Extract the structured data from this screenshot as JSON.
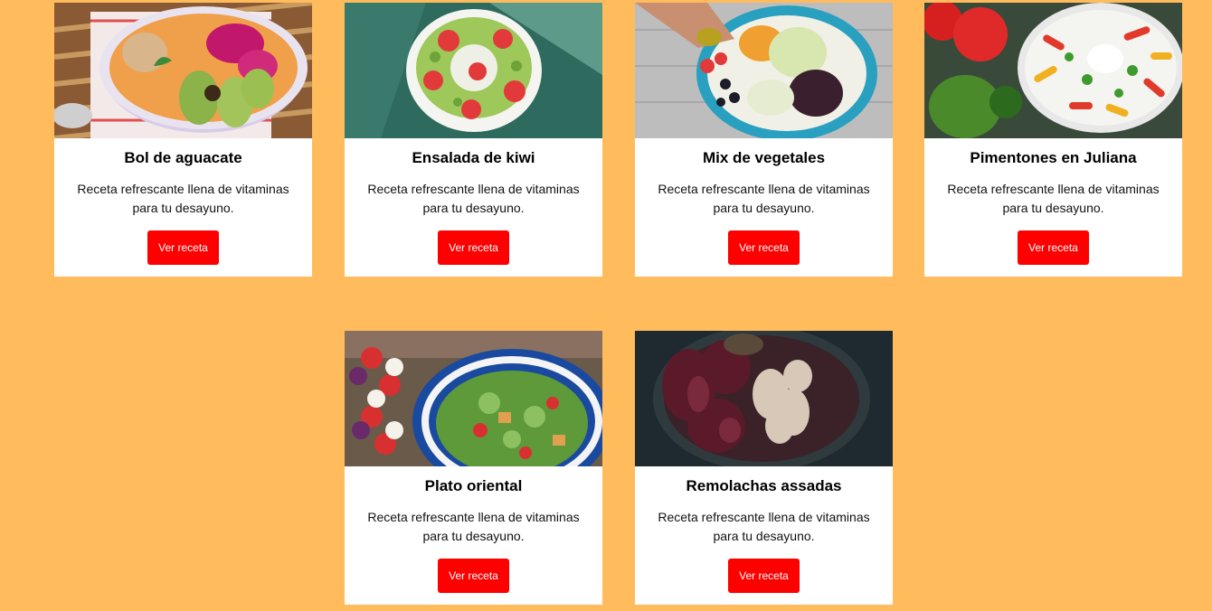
{
  "recipes": [
    {
      "title": "Bol de aguacate",
      "description": "Receta refrescante llena de vitaminas para tu desayuno.",
      "button": "Ver receta",
      "image": "acai-bowl-with-avocado-photo"
    },
    {
      "title": "Ensalada de kiwi",
      "description": "Receta refrescante llena de vitaminas para tu desayuno.",
      "button": "Ver receta",
      "image": "kiwi-strawberry-bowl-photo"
    },
    {
      "title": "Mix de vegetales",
      "description": "Receta refrescante llena de vitaminas para tu desayuno.",
      "button": "Ver receta",
      "image": "vegetable-mix-plate-photo"
    },
    {
      "title": "Pimentones en Juliana",
      "description": "Receta refrescante llena de vitaminas para tu desayuno.",
      "button": "Ver receta",
      "image": "julienned-peppers-salad-photo"
    },
    {
      "title": "Plato oriental",
      "description": "Receta refrescante llena de vitaminas para tu desayuno.",
      "button": "Ver receta",
      "image": "oriental-salad-bowl-photo"
    },
    {
      "title": "Remolachas assadas",
      "description": "Receta refrescante llena de vitaminas para tu desayuno.",
      "button": "Ver receta",
      "image": "roasted-beets-bowl-photo"
    }
  ],
  "colors": {
    "background": "#ffbb5c",
    "card": "#ffffff",
    "button": "#ff0000",
    "button_text": "#ffffff"
  }
}
